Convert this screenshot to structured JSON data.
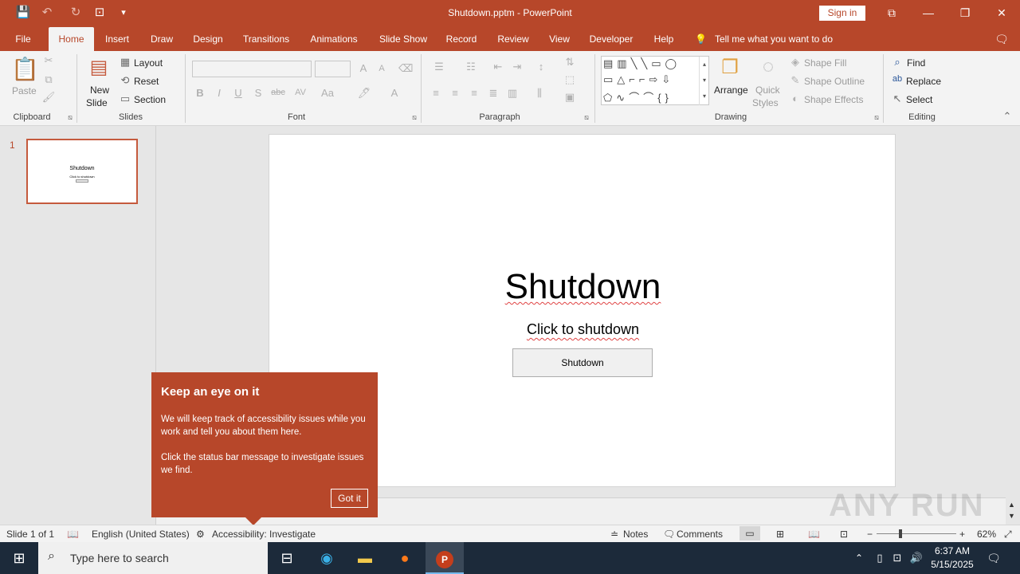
{
  "window": {
    "title": "Shutdown.pptm  -  PowerPoint",
    "sign_in": "Sign in",
    "controls": {
      "display_options": "⧉",
      "minimize": "—",
      "restore": "❐",
      "close": "✕"
    },
    "quick_access": {
      "save": "💾",
      "undo": "↶",
      "redo": "↻",
      "present": "⊡",
      "customize": "▾"
    }
  },
  "tabs": [
    "File",
    "Home",
    "Insert",
    "Draw",
    "Design",
    "Transitions",
    "Animations",
    "Slide Show",
    "Record",
    "Review",
    "View",
    "Developer",
    "Help"
  ],
  "active_tab": "Home",
  "tell_me": "Tell me what you want to do",
  "ribbon": {
    "clipboard": {
      "label": "Clipboard",
      "paste": "Paste"
    },
    "slides": {
      "label": "Slides",
      "new_slide_1": "New",
      "new_slide_2": "Slide",
      "layout": "Layout",
      "reset": "Reset",
      "section": "Section"
    },
    "font": {
      "label": "Font",
      "font_name": "",
      "font_size": "",
      "bold": "B",
      "italic": "I",
      "underline": "U",
      "shadow": "S",
      "strike": "abc",
      "spacing": "AV",
      "case": "Aa",
      "color": "A",
      "grow": "A",
      "shrink": "A"
    },
    "paragraph": {
      "label": "Paragraph"
    },
    "drawing": {
      "label": "Drawing",
      "arrange": "Arrange",
      "quick_styles_1": "Quick",
      "quick_styles_2": "Styles",
      "shape_fill": "Shape Fill",
      "shape_outline": "Shape Outline",
      "shape_effects": "Shape Effects"
    },
    "editing": {
      "label": "Editing",
      "find": "Find",
      "replace": "Replace",
      "select": "Select"
    }
  },
  "thumbnails": [
    {
      "number": "1",
      "title": "Shutdown",
      "subtitle": "Click to shutdown"
    }
  ],
  "slide": {
    "title": "Shutdown",
    "subtitle": "Click to shutdown",
    "button_label": "Shutdown"
  },
  "callout": {
    "title": "Keep an eye on it",
    "paragraph_1": "We will keep track of accessibility issues while you work and tell you about them here.",
    "paragraph_2": "Click the status bar message to investigate issues we find.",
    "button": "Got it"
  },
  "status_bar": {
    "slide_info": "Slide 1 of 1",
    "language": "English (United States)",
    "accessibility": "Accessibility: Investigate",
    "notes": "Notes",
    "comments": "Comments",
    "zoom": "62%"
  },
  "taskbar": {
    "search_placeholder": "Type here to search",
    "time": "6:37 AM",
    "date": "5/15/2025"
  },
  "watermark": "ANY RUN",
  "colors": {
    "accent": "#b7472a",
    "taskbar": "#1c2a3a"
  }
}
